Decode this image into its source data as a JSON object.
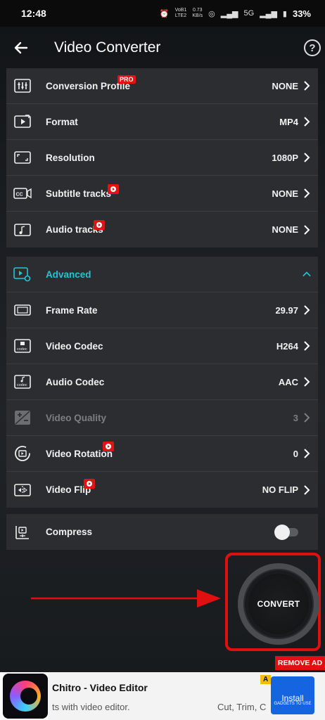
{
  "status_bar": {
    "time": "12:48",
    "network_label_1": "VoB1",
    "network_label_2": "LTE2",
    "speed_1": "0.73",
    "speed_2": "KB/s",
    "signal": "5G",
    "battery": "33%"
  },
  "header": {
    "title": "Video Converter"
  },
  "basic_settings": [
    {
      "label": "Conversion Profile",
      "value": "NONE",
      "badge": "PRO"
    },
    {
      "label": "Format",
      "value": "MP4"
    },
    {
      "label": "Resolution",
      "value": "1080P"
    },
    {
      "label": "Subtitle tracks",
      "value": "NONE",
      "badge": "video"
    },
    {
      "label": "Audio tracks",
      "value": "NONE",
      "badge": "video"
    }
  ],
  "advanced": {
    "label": "Advanced",
    "expanded": true,
    "items": [
      {
        "label": "Frame Rate",
        "value": "29.97"
      },
      {
        "label": "Video Codec",
        "value": "H264"
      },
      {
        "label": "Audio Codec",
        "value": "AAC"
      },
      {
        "label": "Video Quality",
        "value": "3",
        "disabled": true
      },
      {
        "label": "Video Rotation",
        "value": "0",
        "badge": "video"
      },
      {
        "label": "Video Flip",
        "value": "NO FLIP",
        "badge": "video"
      }
    ]
  },
  "compress": {
    "label": "Compress",
    "enabled": false
  },
  "convert_button": {
    "label": "CONVERT"
  },
  "ad": {
    "remove_label": "REMOVE AD",
    "title": "Chitro - Video Editor",
    "description": "ts with video editor.",
    "description_2": "Cut, Trim, C",
    "badge": "A",
    "install_label": "Install",
    "watermark": "GADGETS TO USE"
  },
  "colors": {
    "accent": "#1fc6d6",
    "badge_red": "#e11414",
    "highlight_red": "#e01010",
    "card_bg": "#2b2d30"
  }
}
